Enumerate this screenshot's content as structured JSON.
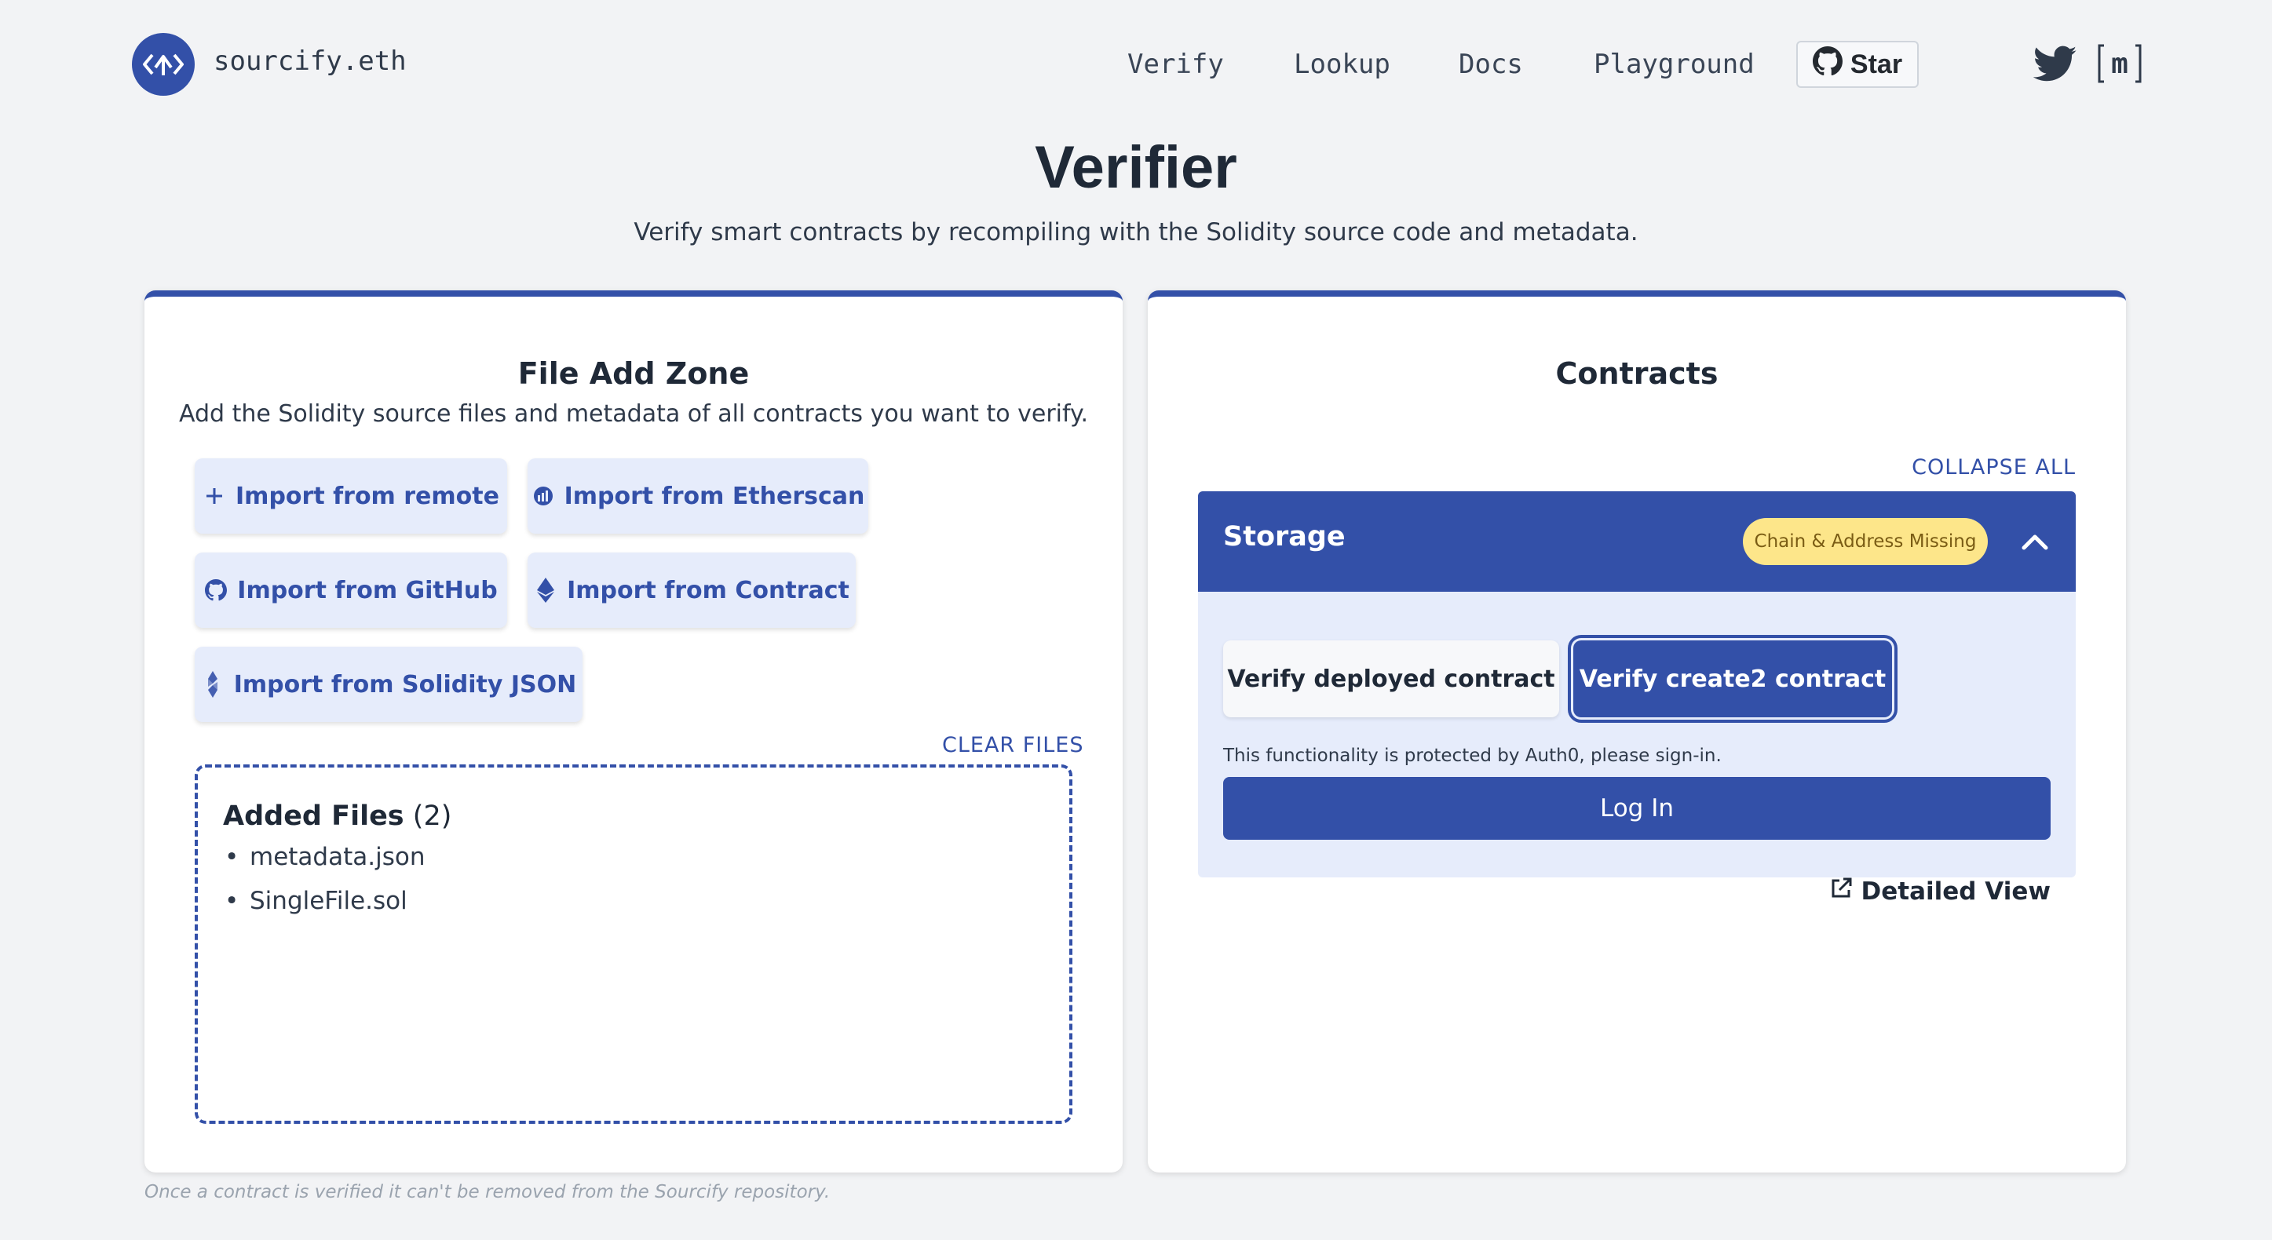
{
  "header": {
    "brand": "sourcify.eth",
    "nav": [
      "Verify",
      "Lookup",
      "Docs",
      "Playground"
    ],
    "star_label": "Star",
    "matrix_label": "m",
    "logo_icon": "sourcify-logo-icon",
    "github_icon": "github-icon",
    "twitter_icon": "twitter-icon",
    "matrix_icon": "matrix-icon"
  },
  "page": {
    "title": "Verifier",
    "subtitle": "Verify smart contracts by recompiling with the Solidity source code and metadata."
  },
  "file_zone": {
    "title": "File Add Zone",
    "description": "Add the Solidity source files and metadata of all contracts you want to verify.",
    "buttons": [
      {
        "label": "Import from remote",
        "icon": "plus-icon"
      },
      {
        "label": "Import from Etherscan",
        "icon": "etherscan-icon"
      },
      {
        "label": "Import from GitHub",
        "icon": "github-icon"
      },
      {
        "label": "Import from Contract",
        "icon": "ethereum-icon"
      },
      {
        "label": "Import from Solidity JSON",
        "icon": "solidity-icon"
      }
    ],
    "clear_label": "CLEAR FILES",
    "added_title": "Added Files",
    "added_count": "(2)",
    "files": [
      "metadata.json",
      "SingleFile.sol"
    ],
    "bullet": "•"
  },
  "contracts": {
    "title": "Contracts",
    "collapse_label": "COLLAPSE ALL",
    "item": {
      "name": "Storage",
      "badge": "Chain & Address Missing",
      "tab_deployed": "Verify deployed contract",
      "tab_create2": "Verify create2 contract",
      "auth_note": "This functionality is protected by Auth0, please sign-in.",
      "login_label": "Log In",
      "detailed_label": "Detailed View"
    }
  },
  "footnote": "Once a contract is verified it can't be removed from the Sourcify repository.",
  "colors": {
    "primary": "#3350a8",
    "light_blue": "#e6ecfb",
    "badge_yellow": "#fde68a",
    "background": "#f2f3f5"
  }
}
